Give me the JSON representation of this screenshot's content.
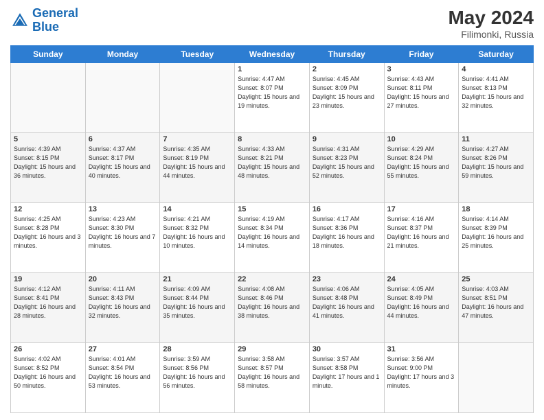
{
  "header": {
    "logo_line1": "General",
    "logo_line2": "Blue",
    "month_year": "May 2024",
    "location": "Filimonki, Russia"
  },
  "days_of_week": [
    "Sunday",
    "Monday",
    "Tuesday",
    "Wednesday",
    "Thursday",
    "Friday",
    "Saturday"
  ],
  "weeks": [
    [
      {
        "day": "",
        "sunrise": "",
        "sunset": "",
        "daylight": ""
      },
      {
        "day": "",
        "sunrise": "",
        "sunset": "",
        "daylight": ""
      },
      {
        "day": "",
        "sunrise": "",
        "sunset": "",
        "daylight": ""
      },
      {
        "day": "1",
        "sunrise": "Sunrise: 4:47 AM",
        "sunset": "Sunset: 8:07 PM",
        "daylight": "Daylight: 15 hours and 19 minutes."
      },
      {
        "day": "2",
        "sunrise": "Sunrise: 4:45 AM",
        "sunset": "Sunset: 8:09 PM",
        "daylight": "Daylight: 15 hours and 23 minutes."
      },
      {
        "day": "3",
        "sunrise": "Sunrise: 4:43 AM",
        "sunset": "Sunset: 8:11 PM",
        "daylight": "Daylight: 15 hours and 27 minutes."
      },
      {
        "day": "4",
        "sunrise": "Sunrise: 4:41 AM",
        "sunset": "Sunset: 8:13 PM",
        "daylight": "Daylight: 15 hours and 32 minutes."
      }
    ],
    [
      {
        "day": "5",
        "sunrise": "Sunrise: 4:39 AM",
        "sunset": "Sunset: 8:15 PM",
        "daylight": "Daylight: 15 hours and 36 minutes."
      },
      {
        "day": "6",
        "sunrise": "Sunrise: 4:37 AM",
        "sunset": "Sunset: 8:17 PM",
        "daylight": "Daylight: 15 hours and 40 minutes."
      },
      {
        "day": "7",
        "sunrise": "Sunrise: 4:35 AM",
        "sunset": "Sunset: 8:19 PM",
        "daylight": "Daylight: 15 hours and 44 minutes."
      },
      {
        "day": "8",
        "sunrise": "Sunrise: 4:33 AM",
        "sunset": "Sunset: 8:21 PM",
        "daylight": "Daylight: 15 hours and 48 minutes."
      },
      {
        "day": "9",
        "sunrise": "Sunrise: 4:31 AM",
        "sunset": "Sunset: 8:23 PM",
        "daylight": "Daylight: 15 hours and 52 minutes."
      },
      {
        "day": "10",
        "sunrise": "Sunrise: 4:29 AM",
        "sunset": "Sunset: 8:24 PM",
        "daylight": "Daylight: 15 hours and 55 minutes."
      },
      {
        "day": "11",
        "sunrise": "Sunrise: 4:27 AM",
        "sunset": "Sunset: 8:26 PM",
        "daylight": "Daylight: 15 hours and 59 minutes."
      }
    ],
    [
      {
        "day": "12",
        "sunrise": "Sunrise: 4:25 AM",
        "sunset": "Sunset: 8:28 PM",
        "daylight": "Daylight: 16 hours and 3 minutes."
      },
      {
        "day": "13",
        "sunrise": "Sunrise: 4:23 AM",
        "sunset": "Sunset: 8:30 PM",
        "daylight": "Daylight: 16 hours and 7 minutes."
      },
      {
        "day": "14",
        "sunrise": "Sunrise: 4:21 AM",
        "sunset": "Sunset: 8:32 PM",
        "daylight": "Daylight: 16 hours and 10 minutes."
      },
      {
        "day": "15",
        "sunrise": "Sunrise: 4:19 AM",
        "sunset": "Sunset: 8:34 PM",
        "daylight": "Daylight: 16 hours and 14 minutes."
      },
      {
        "day": "16",
        "sunrise": "Sunrise: 4:17 AM",
        "sunset": "Sunset: 8:36 PM",
        "daylight": "Daylight: 16 hours and 18 minutes."
      },
      {
        "day": "17",
        "sunrise": "Sunrise: 4:16 AM",
        "sunset": "Sunset: 8:37 PM",
        "daylight": "Daylight: 16 hours and 21 minutes."
      },
      {
        "day": "18",
        "sunrise": "Sunrise: 4:14 AM",
        "sunset": "Sunset: 8:39 PM",
        "daylight": "Daylight: 16 hours and 25 minutes."
      }
    ],
    [
      {
        "day": "19",
        "sunrise": "Sunrise: 4:12 AM",
        "sunset": "Sunset: 8:41 PM",
        "daylight": "Daylight: 16 hours and 28 minutes."
      },
      {
        "day": "20",
        "sunrise": "Sunrise: 4:11 AM",
        "sunset": "Sunset: 8:43 PM",
        "daylight": "Daylight: 16 hours and 32 minutes."
      },
      {
        "day": "21",
        "sunrise": "Sunrise: 4:09 AM",
        "sunset": "Sunset: 8:44 PM",
        "daylight": "Daylight: 16 hours and 35 minutes."
      },
      {
        "day": "22",
        "sunrise": "Sunrise: 4:08 AM",
        "sunset": "Sunset: 8:46 PM",
        "daylight": "Daylight: 16 hours and 38 minutes."
      },
      {
        "day": "23",
        "sunrise": "Sunrise: 4:06 AM",
        "sunset": "Sunset: 8:48 PM",
        "daylight": "Daylight: 16 hours and 41 minutes."
      },
      {
        "day": "24",
        "sunrise": "Sunrise: 4:05 AM",
        "sunset": "Sunset: 8:49 PM",
        "daylight": "Daylight: 16 hours and 44 minutes."
      },
      {
        "day": "25",
        "sunrise": "Sunrise: 4:03 AM",
        "sunset": "Sunset: 8:51 PM",
        "daylight": "Daylight: 16 hours and 47 minutes."
      }
    ],
    [
      {
        "day": "26",
        "sunrise": "Sunrise: 4:02 AM",
        "sunset": "Sunset: 8:52 PM",
        "daylight": "Daylight: 16 hours and 50 minutes."
      },
      {
        "day": "27",
        "sunrise": "Sunrise: 4:01 AM",
        "sunset": "Sunset: 8:54 PM",
        "daylight": "Daylight: 16 hours and 53 minutes."
      },
      {
        "day": "28",
        "sunrise": "Sunrise: 3:59 AM",
        "sunset": "Sunset: 8:56 PM",
        "daylight": "Daylight: 16 hours and 56 minutes."
      },
      {
        "day": "29",
        "sunrise": "Sunrise: 3:58 AM",
        "sunset": "Sunset: 8:57 PM",
        "daylight": "Daylight: 16 hours and 58 minutes."
      },
      {
        "day": "30",
        "sunrise": "Sunrise: 3:57 AM",
        "sunset": "Sunset: 8:58 PM",
        "daylight": "Daylight: 17 hours and 1 minute."
      },
      {
        "day": "31",
        "sunrise": "Sunrise: 3:56 AM",
        "sunset": "Sunset: 9:00 PM",
        "daylight": "Daylight: 17 hours and 3 minutes."
      },
      {
        "day": "",
        "sunrise": "",
        "sunset": "",
        "daylight": ""
      }
    ]
  ]
}
